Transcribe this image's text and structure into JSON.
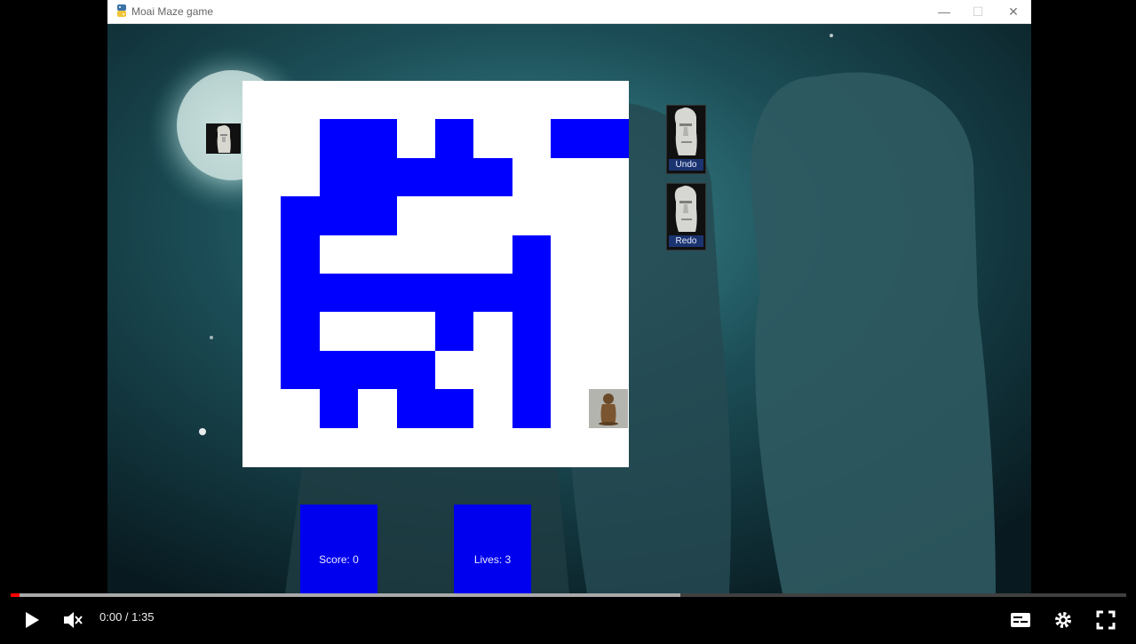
{
  "window": {
    "title": "Moai Maze game",
    "controls": {
      "minimize": "—",
      "maximize": "☐",
      "close": "✕"
    }
  },
  "maze": {
    "grid": [
      "..........",
      "..##.#..##",
      "..#####...",
      ".###......",
      ".#.....#..",
      ".#######..",
      ".#...#.#..",
      ".####..#..",
      "..#.##.#..",
      ".........."
    ],
    "wall_color": "#0000ff",
    "path_color": "#ffffff"
  },
  "buttons": {
    "undo": "Undo",
    "redo": "Redo"
  },
  "status": {
    "score": "Score: 0",
    "lives": "Lives: 3"
  },
  "player": {
    "time": "0:00 / 1:35",
    "progress_played": 0.008,
    "progress_buffered": 0.6
  }
}
